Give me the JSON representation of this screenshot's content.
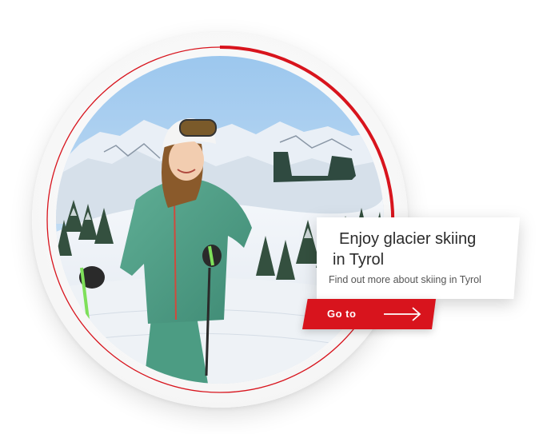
{
  "teaser": {
    "title_line1": "Enjoy glacier skiing",
    "title_line2": "in Tyrol",
    "subtitle": "Find out more about skiing in Tyrol",
    "cta_label": "Go to",
    "cta_icon": "arrow-right-icon"
  },
  "photo": {
    "subject": "skier-woman-photo"
  },
  "colors": {
    "accent": "#d8141d",
    "ring": "#d8141d",
    "text": "#2b2b2b",
    "subtext": "#555555"
  }
}
